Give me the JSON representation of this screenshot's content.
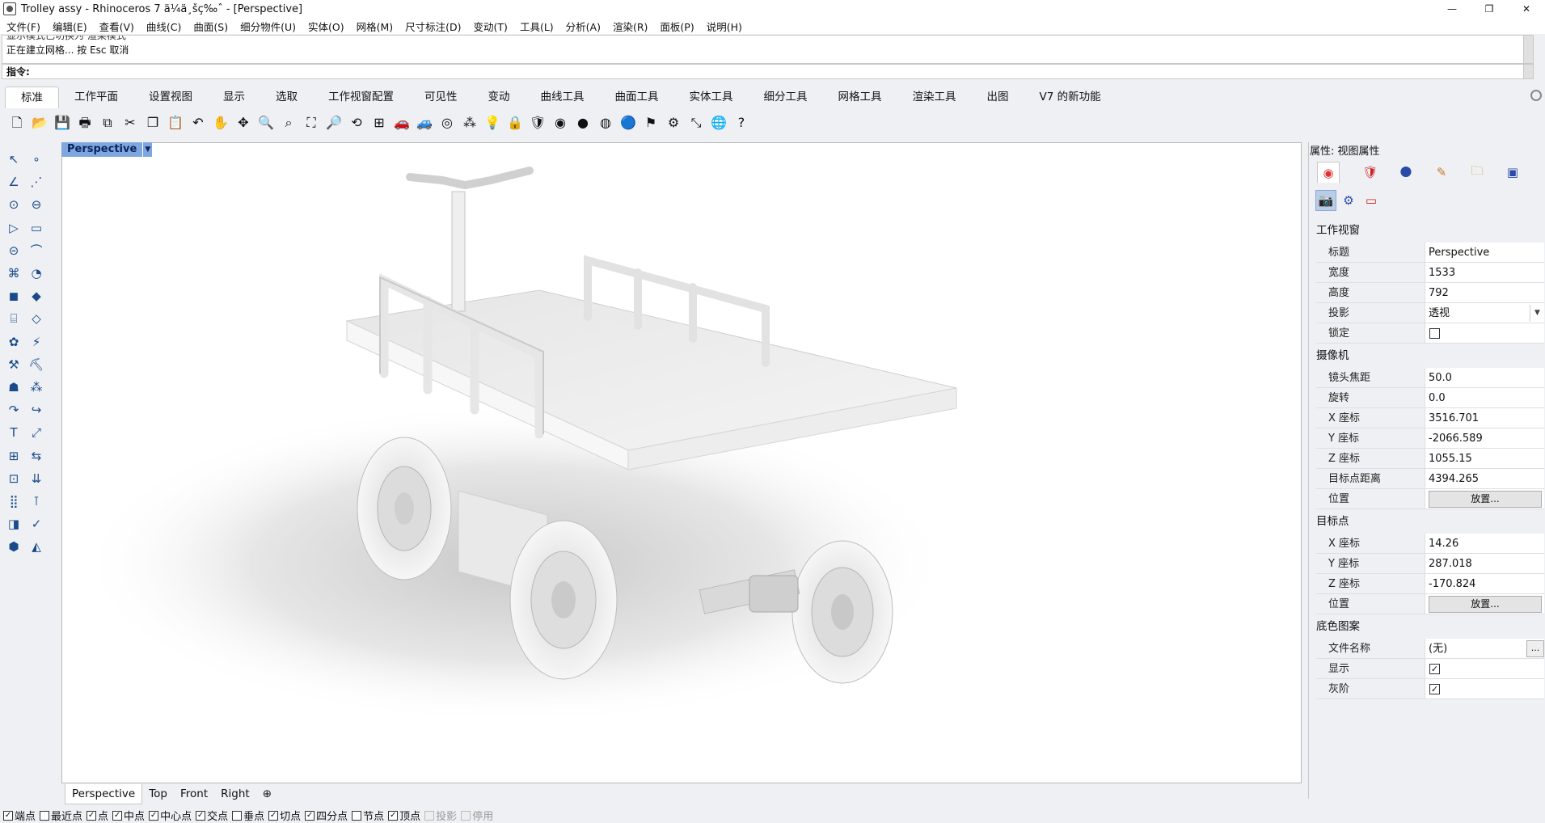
{
  "window": {
    "title": "Trolley assy - Rhinoceros 7 ä¼ä¸šç‰ˆ - [Perspective]",
    "minimize": "—",
    "restore": "❐",
    "close": "✕"
  },
  "menu": [
    "文件(F)",
    "编辑(E)",
    "查看(V)",
    "曲线(C)",
    "曲面(S)",
    "细分物件(U)",
    "实体(O)",
    "网格(M)",
    "尺寸标注(D)",
    "变动(T)",
    "工具(L)",
    "分析(A)",
    "渲染(R)",
    "面板(P)",
    "说明(H)"
  ],
  "history": {
    "line1": "显示模式已切换为 渲染模式",
    "line2": "正在建立网格... 按 Esc 取消"
  },
  "command": {
    "prompt": "指令:"
  },
  "tabs": [
    "标准",
    "工作平面",
    "设置视图",
    "显示",
    "选取",
    "工作视窗配置",
    "可见性",
    "变动",
    "曲线工具",
    "曲面工具",
    "实体工具",
    "细分工具",
    "网格工具",
    "渲染工具",
    "出图",
    "V7 的新功能"
  ],
  "toolbar_icons": [
    "new-icon",
    "open-icon",
    "save-icon",
    "print-icon",
    "import-icon",
    "cut-icon",
    "copy-icon",
    "paste-icon",
    "undo-icon",
    "pan-icon",
    "move-view-icon",
    "zoom-icon",
    "zoom-window-icon",
    "zoom-extents-icon",
    "zoom-selected-icon",
    "rotate-view-icon",
    "four-viewports-icon",
    "car-icon",
    "car-show-icon",
    "circle-point-icon",
    "select-points-icon",
    "light-icon",
    "lock-icon",
    "render-icon",
    "color-wheel-icon",
    "sphere-shaded-icon",
    "sphere-render-icon",
    "sphere-blue-icon",
    "flag-icon",
    "gear-icon",
    "dimension-icon",
    "globe-icon",
    "help-icon"
  ],
  "toolbar_glyphs": [
    "🗋",
    "📂",
    "💾",
    "🖶",
    "⧉",
    "✂",
    "❐",
    "📋",
    "↶",
    "✋",
    "✥",
    "🔍",
    "⌕",
    "⛶",
    "🔎",
    "⟲",
    "⊞",
    "🚗",
    "🚙",
    "◎",
    "⁂",
    "💡",
    "🔒",
    "🛡",
    "◉",
    "●",
    "◍",
    "🔵",
    "⚑",
    "⚙",
    "⤡",
    "🌐",
    "?"
  ],
  "left_tool_glyphs": [
    "↖",
    "∘",
    "∠",
    "⋰",
    "⊙",
    "⊖",
    "▷",
    "▭",
    "⊝",
    "⌒",
    "⌘",
    "◔",
    "◼",
    "◆",
    "⌸",
    "◇",
    "✿",
    "⚡",
    "⚒",
    "⛏",
    "☗",
    "⁂",
    "↷",
    "↪",
    "T",
    "⤢",
    "⊞",
    "⇆",
    "⊡",
    "⇊",
    "⣿",
    "⊺",
    "◨",
    "✓",
    "⬢",
    "◭"
  ],
  "viewport": {
    "name": "Perspective",
    "dropdown": "▼"
  },
  "viewport_tabs": [
    "Perspective",
    "Top",
    "Front",
    "Right",
    "⊕"
  ],
  "osnaps": [
    {
      "label": "端点",
      "checked": true
    },
    {
      "label": "最近点",
      "checked": false
    },
    {
      "label": "点",
      "checked": true
    },
    {
      "label": "中点",
      "checked": true
    },
    {
      "label": "中心点",
      "checked": true
    },
    {
      "label": "交点",
      "checked": true
    },
    {
      "label": "垂点",
      "checked": false
    },
    {
      "label": "切点",
      "checked": true
    },
    {
      "label": "四分点",
      "checked": true
    },
    {
      "label": "节点",
      "checked": false
    },
    {
      "label": "顶点",
      "checked": true
    },
    {
      "label": "投影",
      "checked": false,
      "disabled": true
    },
    {
      "label": "停用",
      "checked": false,
      "disabled": true
    }
  ],
  "panel": {
    "header": "属性: 视图属性",
    "tab_icons": [
      "color-circle-icon",
      "material-icon",
      "environment-icon",
      "texture-icon",
      "folder-icon",
      "render-settings-icon"
    ],
    "tab_glyphs": [
      "◉",
      "🛡",
      "🌑",
      "✎",
      "🗀",
      "▣"
    ],
    "view_icons": [
      "camera-icon",
      "gumball-icon",
      "frame-icon"
    ],
    "view_glyphs": [
      "📷",
      "⚙",
      "▭"
    ],
    "viewport_section": "工作视窗",
    "title_label": "标题",
    "title_value": "Perspective",
    "width_label": "宽度",
    "width_value": "1533",
    "height_label": "高度",
    "height_value": "792",
    "projection_label": "投影",
    "projection_value": "透视",
    "lock_label": "锁定",
    "camera_section": "摄像机",
    "lens_label": "镜头焦距",
    "lens_value": "50.0",
    "rotation_label": "旋转",
    "rotation_value": "0.0",
    "cam_x_label": "X 座标",
    "cam_x_value": "3516.701",
    "cam_y_label": "Y 座标",
    "cam_y_value": "-2066.589",
    "cam_z_label": "Z 座标",
    "cam_z_value": "1055.15",
    "target_dist_label": "目标点距离",
    "target_dist_value": "4394.265",
    "cam_pos_label": "位置",
    "place_button": "放置...",
    "target_section": "目标点",
    "tgt_x_label": "X 座标",
    "tgt_x_value": "14.26",
    "tgt_y_label": "Y 座标",
    "tgt_y_value": "287.018",
    "tgt_z_label": "Z 座标",
    "tgt_z_value": "-170.824",
    "tgt_pos_label": "位置",
    "background_section": "底色图案",
    "filename_label": "文件名称",
    "filename_value": "(无)",
    "browse_button": "...",
    "show_label": "显示",
    "gray_label": "灰阶"
  }
}
